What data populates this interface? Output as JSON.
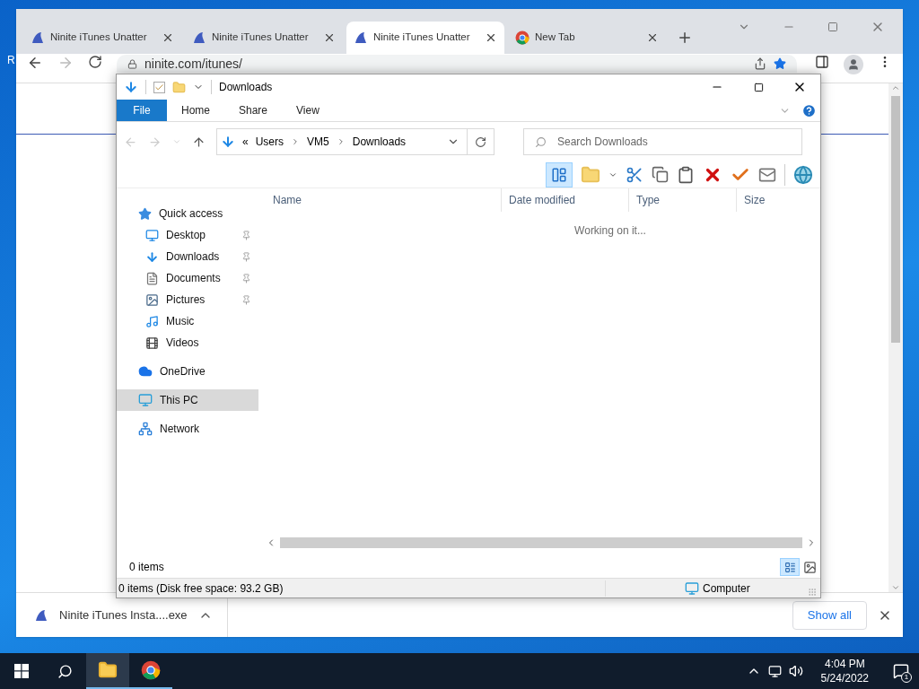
{
  "desktop": {
    "label": "R"
  },
  "browser": {
    "tabs": [
      {
        "title": "Ninite iTunes Unatter",
        "kind": "ninite",
        "selected": false
      },
      {
        "title": "Ninite iTunes Unatter",
        "kind": "ninite",
        "selected": false
      },
      {
        "title": "Ninite iTunes Unatter",
        "kind": "ninite",
        "selected": true
      },
      {
        "title": "New Tab",
        "kind": "chrome",
        "selected": false
      }
    ],
    "url": "ninite.com/itunes/",
    "bookmarked": true,
    "download": {
      "file": "Ninite iTunes Insta....exe",
      "show_all": "Show all"
    }
  },
  "explorer": {
    "title": "Downloads",
    "ribbon_tabs": [
      {
        "label": "File",
        "selected": true
      },
      {
        "label": "Home",
        "selected": false
      },
      {
        "label": "Share",
        "selected": false
      },
      {
        "label": "View",
        "selected": false
      }
    ],
    "path_prefix": "«",
    "path": [
      "Users",
      "VM5",
      "Downloads"
    ],
    "search_placeholder": "Search Downloads",
    "nav": [
      {
        "label": "Quick access",
        "kind": "star",
        "selected": false,
        "children": [
          {
            "label": "Desktop",
            "kind": "desktop",
            "pinned": true,
            "selected": false
          },
          {
            "label": "Downloads",
            "kind": "download",
            "pinned": true,
            "selected": false
          },
          {
            "label": "Documents",
            "kind": "document",
            "pinned": true,
            "selected": false
          },
          {
            "label": "Pictures",
            "kind": "picture",
            "pinned": true,
            "selected": false
          },
          {
            "label": "Music",
            "kind": "music",
            "pinned": false,
            "selected": false
          },
          {
            "label": "Videos",
            "kind": "video",
            "pinned": false,
            "selected": false
          }
        ]
      },
      {
        "label": "OneDrive",
        "kind": "cloud",
        "selected": false
      },
      {
        "label": "This PC",
        "kind": "pc",
        "selected": true
      },
      {
        "label": "Network",
        "kind": "network",
        "selected": false
      }
    ],
    "columns": [
      "Name",
      "Date modified",
      "Type",
      "Size"
    ],
    "message": "Working on it...",
    "item_count": "0 items",
    "status_bar": {
      "left": "0 items (Disk free space: 93.2 GB)",
      "right": "Computer"
    }
  },
  "taskbar": {
    "apps": [
      {
        "kind": "explorer",
        "selected": true
      },
      {
        "kind": "chrome",
        "selected": false
      }
    ],
    "time": "4:04 PM",
    "date": "5/24/2022",
    "notifications": "1"
  }
}
